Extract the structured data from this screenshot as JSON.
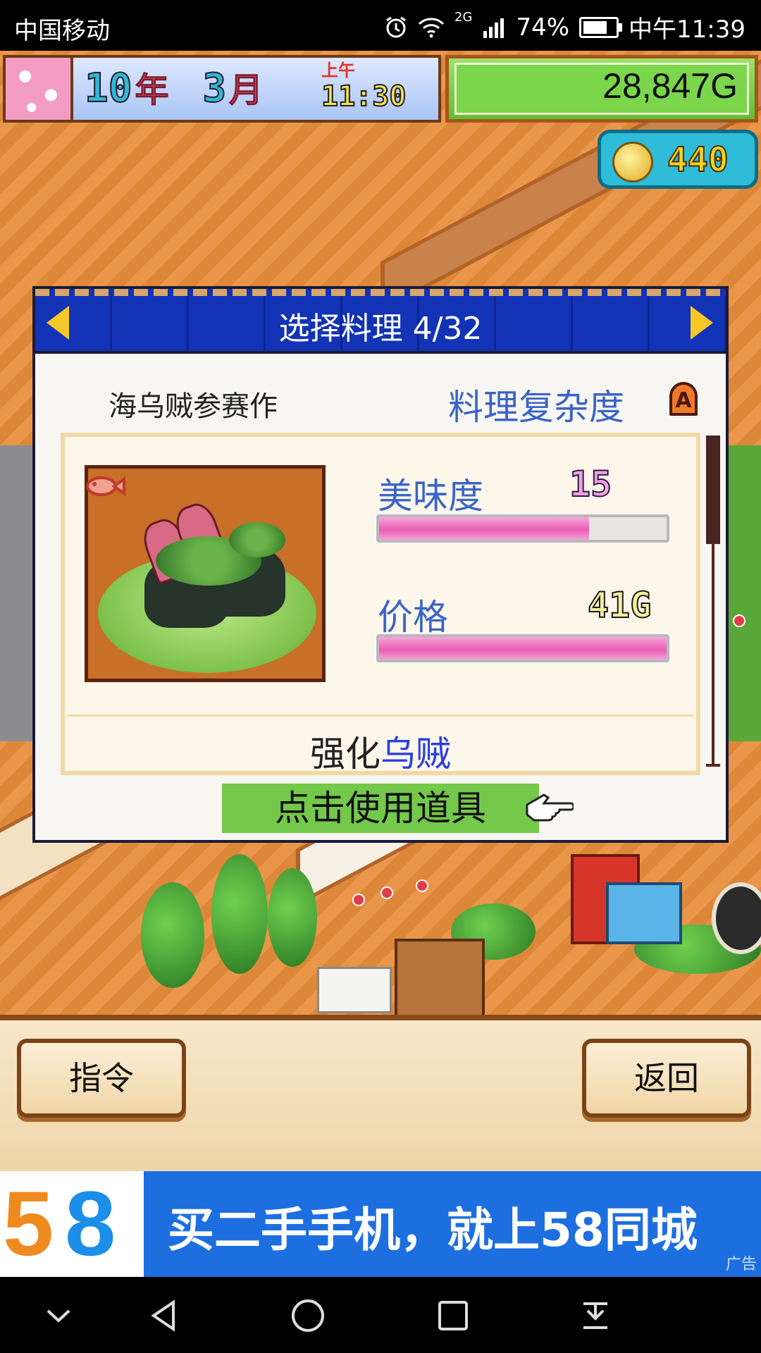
{
  "status_bar": {
    "carrier": "中国移动",
    "network": "2G",
    "battery": "74%",
    "battery_level": 0.74,
    "time": "中午11:39"
  },
  "top_bar": {
    "year_num": "10",
    "year_unit": "年",
    "month_num": "3",
    "month_unit": "月",
    "ampm": "上午",
    "clock": "11:30",
    "money": "28,847G",
    "coins": "440"
  },
  "dialog": {
    "title": "选择料理 4/32",
    "dish_name": "海乌贼参赛作",
    "complexity_label": "料理复杂度",
    "complexity_rank": "A",
    "stats": [
      {
        "label": "美味度",
        "value": "15",
        "fill": 0.73,
        "value_color": "#f3a3e0"
      },
      {
        "label": "价格",
        "value": "41G",
        "fill": 1.0,
        "value_color": "#f6f09a"
      }
    ],
    "enhance_prefix": "强化",
    "enhance_target": "乌贼",
    "use_item": "点击使用道具",
    "scroll_position": 0.0
  },
  "commands": {
    "command": "指令",
    "back": "返回"
  },
  "ad": {
    "logo": "58",
    "text": "买二手手机，就上58同城",
    "tag": "广告"
  },
  "icons": {
    "alarm": "alarm-icon",
    "wifi": "wifi-icon",
    "signal": "signal-icon",
    "coin": "coin-icon",
    "fish": "fish-icon",
    "hand": "pointing-hand-icon"
  }
}
